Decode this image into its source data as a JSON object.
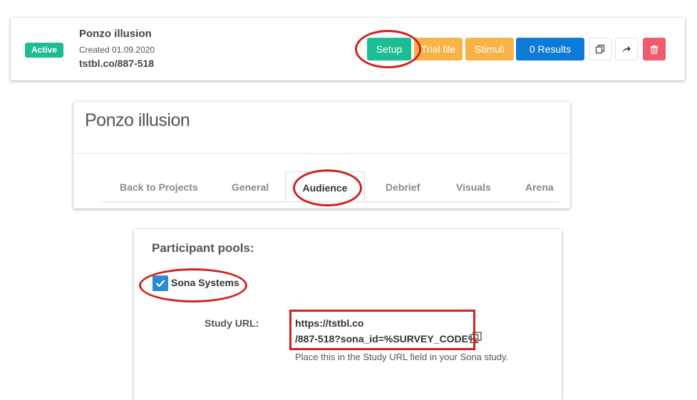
{
  "project": {
    "status": "Active",
    "title": "Ponzo illusion",
    "created": "Created 01.09.2020",
    "short_url": "tstbl.co/887-518",
    "buttons": {
      "setup": "Setup",
      "trial_file": "Trial file",
      "stimuli": "Stimuli",
      "results": "0 Results"
    },
    "icons": [
      "copy-icon",
      "share-icon",
      "trash-icon"
    ]
  },
  "setup_page": {
    "title": "Ponzo illusion",
    "tabs": [
      {
        "label": "Back to Projects"
      },
      {
        "label": "General"
      },
      {
        "label": "Audience",
        "active": true
      },
      {
        "label": "Debrief"
      },
      {
        "label": "Visuals"
      },
      {
        "label": "Arena"
      }
    ]
  },
  "audience": {
    "pools_title": "Participant pools:",
    "pool_label": "Sona Systems",
    "pool_checked": true,
    "study_url_label": "Study URL:",
    "study_url_line1": "https://tstbl.co",
    "study_url_line2": "/887-518?sona_id=%SURVEY_CODE%",
    "help_text": "Place this in the Study URL field in your Sona study."
  },
  "colors": {
    "green": "#1ebc93",
    "orange": "#f7b248",
    "blue": "#0c7ad6",
    "red": "#ef5b6c",
    "annotation_red": "#d42020"
  }
}
